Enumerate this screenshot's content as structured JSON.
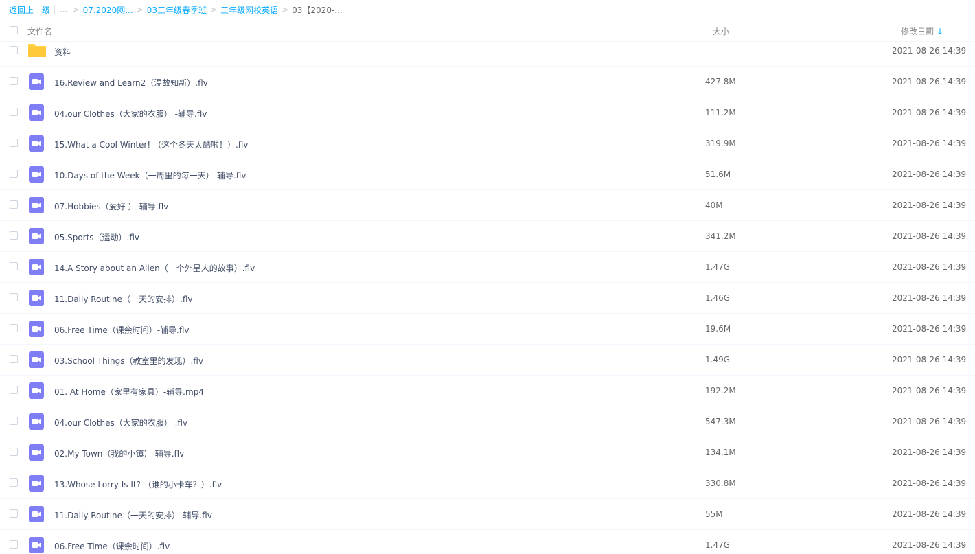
{
  "breadcrumb": {
    "back": "返回上一级",
    "ellipsis": "...",
    "items": [
      "07.2020网...",
      "03三年级春季班",
      "三年级网校英语"
    ],
    "current": "03【2020-..."
  },
  "header": {
    "name": "文件名",
    "size": "大小",
    "date": "修改日期",
    "sort_arrow": "↓"
  },
  "files": [
    {
      "type": "folder",
      "name": "资料",
      "size": "-",
      "date": "2021-08-26 14:39"
    },
    {
      "type": "video",
      "name": "16.Review and Learn2（温故知新）.flv",
      "size": "427.8M",
      "date": "2021-08-26 14:39"
    },
    {
      "type": "video",
      "name": "04.our Clothes（大家的衣服） -辅导.flv",
      "size": "111.2M",
      "date": "2021-08-26 14:39"
    },
    {
      "type": "video",
      "name": "15.What a Cool Winter! （这个冬天太酷啦！）.flv",
      "size": "319.9M",
      "date": "2021-08-26 14:39"
    },
    {
      "type": "video",
      "name": "10.Days of the Week（一周里的每一天）-辅导.flv",
      "size": "51.6M",
      "date": "2021-08-26 14:39"
    },
    {
      "type": "video",
      "name": "07.Hobbies（爱好 ）-辅导.flv",
      "size": "40M",
      "date": "2021-08-26 14:39"
    },
    {
      "type": "video",
      "name": "05.Sports（运动）.flv",
      "size": "341.2M",
      "date": "2021-08-26 14:39"
    },
    {
      "type": "video",
      "name": "14.A Story about an Alien（一个外星人的故事）.flv",
      "size": "1.47G",
      "date": "2021-08-26 14:39"
    },
    {
      "type": "video",
      "name": "11.Daily Routine（一天的安排）.flv",
      "size": "1.46G",
      "date": "2021-08-26 14:39"
    },
    {
      "type": "video",
      "name": "06.Free Time（课余时间）-辅导.flv",
      "size": "19.6M",
      "date": "2021-08-26 14:39"
    },
    {
      "type": "video",
      "name": "03.School Things（教室里的发现）.flv",
      "size": "1.49G",
      "date": "2021-08-26 14:39"
    },
    {
      "type": "video",
      "name": "01. At Home（家里有家具）-辅导.mp4",
      "size": "192.2M",
      "date": "2021-08-26 14:39"
    },
    {
      "type": "video",
      "name": "04.our Clothes（大家的衣服） .flv",
      "size": "547.3M",
      "date": "2021-08-26 14:39"
    },
    {
      "type": "video",
      "name": "02.My Town（我的小镇）-辅导.flv",
      "size": "134.1M",
      "date": "2021-08-26 14:39"
    },
    {
      "type": "video",
      "name": "13.Whose Lorry Is It? （谁的小卡车？）.flv",
      "size": "330.8M",
      "date": "2021-08-26 14:39"
    },
    {
      "type": "video",
      "name": "11.Daily Routine（一天的安排）-辅导.flv",
      "size": "55M",
      "date": "2021-08-26 14:39"
    },
    {
      "type": "video",
      "name": "06.Free Time（课余时间）.flv",
      "size": "1.47G",
      "date": "2021-08-26 14:39"
    }
  ],
  "colors": {
    "link": "#09aaff",
    "folder": "#ffd24a",
    "video": "#7f7ef5"
  }
}
